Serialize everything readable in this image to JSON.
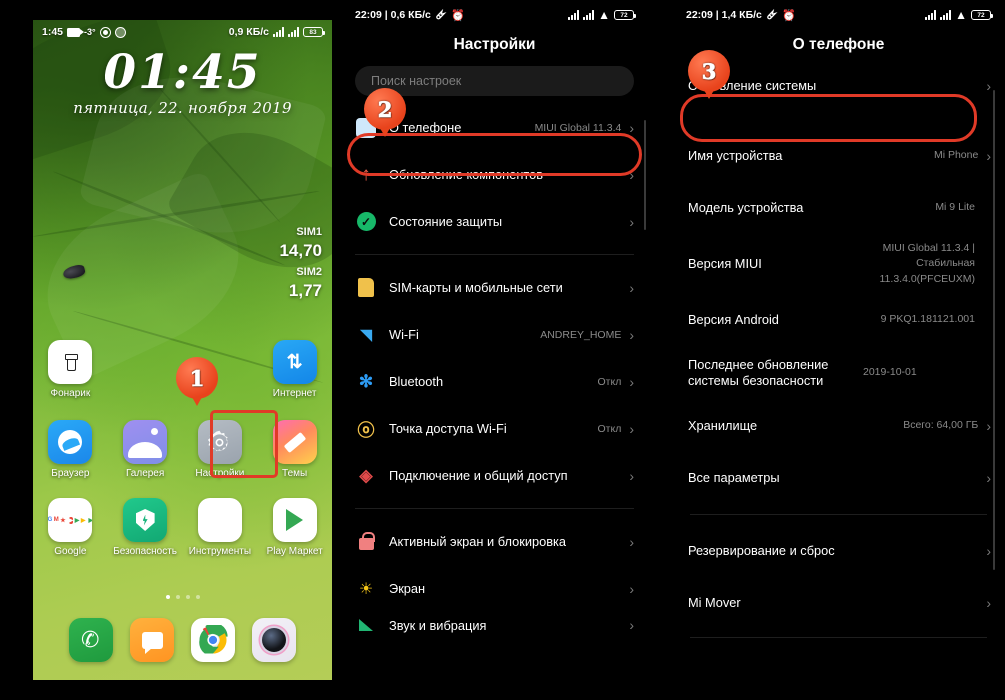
{
  "home": {
    "status": {
      "time": "1:45",
      "temp": "-3°",
      "speed": "0,9 КБ/c",
      "battery": "83",
      "icons": [
        "video-camera-icon",
        "temperature-icon",
        "record-icon",
        "app-icon"
      ]
    },
    "lock": {
      "time": "01:45",
      "date": "пятница, 22. ноября 2019"
    },
    "sim_widget": [
      {
        "label": "SIM1",
        "value": "14,70"
      },
      {
        "label": "SIM2",
        "value": "1,77"
      }
    ],
    "row_torch": {
      "label": "Фонарик"
    },
    "row_internet": {
      "label": "Интернет"
    },
    "apps_row1": [
      {
        "label": "Браузер",
        "icon": "browser-icon"
      },
      {
        "label": "Галерея",
        "icon": "gallery-icon"
      },
      {
        "label": "Настройки",
        "icon": "settings-gear-icon"
      },
      {
        "label": "Темы",
        "icon": "themes-icon"
      }
    ],
    "apps_row2": [
      {
        "label": "Google",
        "icon": "google-folder-icon"
      },
      {
        "label": "Безопасность",
        "icon": "security-shield-icon"
      },
      {
        "label": "Инструменты",
        "icon": "tools-folder-icon"
      },
      {
        "label": "Play Маркет",
        "icon": "play-store-icon"
      }
    ],
    "dock": [
      {
        "icon": "phone-icon"
      },
      {
        "icon": "messages-icon"
      },
      {
        "icon": "chrome-icon"
      },
      {
        "icon": "camera-icon"
      }
    ],
    "page_dots": 4,
    "page_active": 0
  },
  "settings": {
    "status": {
      "time": "22:09",
      "speed": "0,6 КБ/c",
      "battery": "72"
    },
    "title": "Настройки",
    "search_placeholder": "Поиск настроек",
    "group1": [
      {
        "label": "О телефоне",
        "value": "MIUI Global 11.3.4",
        "icon": "about-phone-icon",
        "chevron": true
      },
      {
        "label": "Обновление компонентов",
        "value": "",
        "icon": "update-arrow-icon",
        "chevron": true
      },
      {
        "label": "Состояние защиты",
        "value": "",
        "icon": "security-check-icon",
        "chevron": true
      }
    ],
    "group2": [
      {
        "label": "SIM-карты и мобильные сети",
        "value": "",
        "icon": "sim-card-icon",
        "chevron": true
      },
      {
        "label": "Wi-Fi",
        "value": "ANDREY_HOME",
        "icon": "wifi-icon",
        "chevron": true
      },
      {
        "label": "Bluetooth",
        "value": "Откл",
        "icon": "bluetooth-icon",
        "chevron": true
      },
      {
        "label": "Точка доступа Wi-Fi",
        "value": "Откл",
        "icon": "hotspot-icon",
        "chevron": true
      },
      {
        "label": "Подключение и общий доступ",
        "value": "",
        "icon": "share-connection-icon",
        "chevron": true
      }
    ],
    "group3": [
      {
        "label": "Активный экран и блокировка",
        "value": "",
        "icon": "lock-icon",
        "chevron": true
      },
      {
        "label": "Экран",
        "value": "",
        "icon": "brightness-icon",
        "chevron": true
      },
      {
        "label": "Звук и вибрация",
        "value": "",
        "icon": "volume-icon",
        "chevron": true
      }
    ]
  },
  "about": {
    "status": {
      "time": "22:09",
      "speed": "1,4 КБ/c",
      "battery": "72"
    },
    "title": "О телефоне",
    "update_row": {
      "label": "Обновление системы",
      "chevron": true
    },
    "rows": [
      {
        "label": "Имя устройства",
        "value": "Mi Phone",
        "chevron": true
      },
      {
        "label": "Модель устройства",
        "value": "Mi 9 Lite",
        "chevron": false
      },
      {
        "label": "Версия MIUI",
        "value": "MIUI Global 11.3.4 |\nСтабильная\n11.3.4.0(PFCEUXM)",
        "chevron": false
      },
      {
        "label": "Версия Android",
        "value": "9 PKQ1.181121.001",
        "chevron": false
      },
      {
        "label": "Последнее обновление системы безопасности",
        "value": "2019-10-01",
        "chevron": false
      },
      {
        "label": "Хранилище",
        "value": "Всего: 64,00 ГБ",
        "chevron": true
      },
      {
        "label": "Все параметры",
        "value": "",
        "chevron": true
      }
    ],
    "rows_bottom": [
      {
        "label": "Резервирование и сброс",
        "value": "",
        "chevron": true
      },
      {
        "label": "Mi Mover",
        "value": "",
        "chevron": true
      }
    ]
  },
  "annotations": {
    "badge1": "1",
    "badge2": "2",
    "badge3": "3",
    "highlight_color": "#e03a27"
  }
}
